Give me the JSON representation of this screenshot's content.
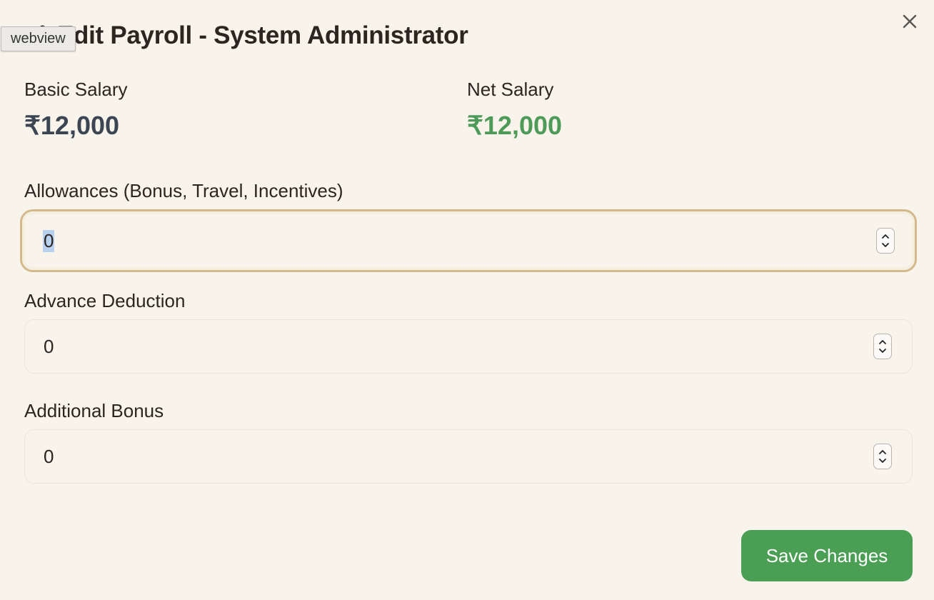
{
  "tooltip": "webview",
  "title": "Edit Payroll - System Administrator",
  "summary": {
    "basic_label": "Basic Salary",
    "basic_value": "₹12,000",
    "net_label": "Net Salary",
    "net_value": "₹12,000"
  },
  "fields": [
    {
      "label": "Allowances (Bonus, Travel, Incentives)",
      "value": "0"
    },
    {
      "label": "Advance Deduction",
      "value": "0"
    },
    {
      "label": "Additional Bonus",
      "value": "0"
    }
  ],
  "save_label": "Save Changes",
  "colors": {
    "background": "#f8f4ec",
    "accent_green": "#4a9f55",
    "net_green": "#4e9a58",
    "focus_border": "#d4b98c"
  },
  "icons": {
    "title": "edit-icon",
    "close": "close-icon",
    "stepper": "stepper-icon"
  }
}
